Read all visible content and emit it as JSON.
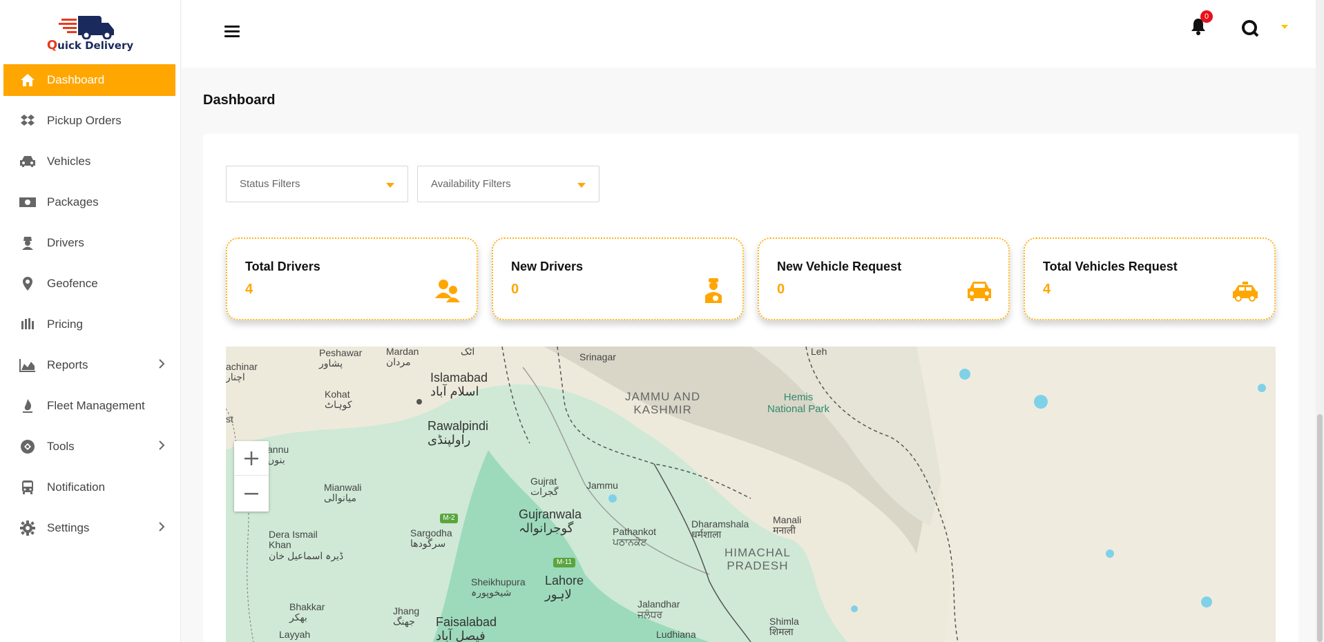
{
  "brand": {
    "q": "Q",
    "rest": "uick Delivery"
  },
  "sidebar": {
    "items": [
      {
        "label": "Dashboard",
        "icon": "home-icon",
        "active": true
      },
      {
        "label": "Pickup Orders",
        "icon": "dropbox-icon"
      },
      {
        "label": "Vehicles",
        "icon": "car-icon"
      },
      {
        "label": "Packages",
        "icon": "money-icon"
      },
      {
        "label": "Drivers",
        "icon": "user-secret-icon"
      },
      {
        "label": "Geofence",
        "icon": "map-pin-icon"
      },
      {
        "label": "Pricing",
        "icon": "hand-icon"
      },
      {
        "label": "Reports",
        "icon": "area-chart-icon",
        "expandable": true
      },
      {
        "label": "Fleet Management",
        "icon": "fire-icon"
      },
      {
        "label": "Tools",
        "icon": "tools-icon",
        "expandable": true
      },
      {
        "label": "Notification",
        "icon": "bus-icon"
      },
      {
        "label": "Settings",
        "icon": "gear-icon",
        "expandable": true
      }
    ]
  },
  "header": {
    "notification_count": "0"
  },
  "page": {
    "title": "Dashboard"
  },
  "filters": {
    "status": "Status Filters",
    "availability": "Availability Filters"
  },
  "stats": [
    {
      "title": "Total Drivers",
      "value": "4",
      "icon": "users-icon"
    },
    {
      "title": "New Drivers",
      "value": "0",
      "icon": "driver-icon"
    },
    {
      "title": "New Vehicle Request",
      "value": "0",
      "icon": "car-icon"
    },
    {
      "title": "Total Vehicles Request",
      "value": "4",
      "icon": "taxi-icon"
    }
  ],
  "map": {
    "labels": {
      "peshawar": "Peshawar\nپشاور",
      "mardan": "Mardan\nمردان",
      "attock": "اٹک",
      "islamabad": "Islamabad\nاسلام آباد",
      "srinagar": "Srinagar",
      "leh": "Leh",
      "chinar": "achinar\nاچنار",
      "kohat": "Kohat\nکوہاٹ",
      "rawalpindi": "Rawalpindi\nراولپنڈی",
      "jk": "JAMMU AND\nKASHMIR",
      "hemis": "Hemis\nNational Park",
      "st": "st",
      "bannu": "annu\nبنوں",
      "mianwali": "Mianwali\nمیانوالی",
      "gujrat": "Gujrat\nگجرات",
      "jammu": "Jammu",
      "gujranwala": "Gujranwala\nگوجرانوالہ",
      "sargodha": "Sargodha\nسرگودھا",
      "pathankot": "Pathankot\nਪਠਾਨਕੋਟ",
      "dharamshala": "Dharamshala\nधर्मशाला",
      "manali": "Manali\nमनाली",
      "die": "Dera Ismail\nKhan\nڈیرہ اسماعیل خان",
      "hp": "HIMACHAL\nPRADESH",
      "sheikhupura": "Sheikhupura\nشیخوپورہ",
      "lahore": "Lahore\nلاہور",
      "jalandhar": "Jalandhar\nਜਲੰਧਰ",
      "bhakkar": "Bhakkar\nبھکر",
      "jhang": "Jhang\nجھنگ",
      "faisalabad": "Faisalabad\nفیصل آباد",
      "shimla": "Shimla\nशिमला",
      "layyah": "Layyah",
      "ludhiana": "Ludhiana"
    },
    "shields": {
      "m2": "M-2",
      "m11": "M-11"
    }
  },
  "colors": {
    "accent": "#ffa600",
    "badge": "#e8101a",
    "brand_navy": "#1b2a5c",
    "brand_red": "#e63a1e"
  }
}
